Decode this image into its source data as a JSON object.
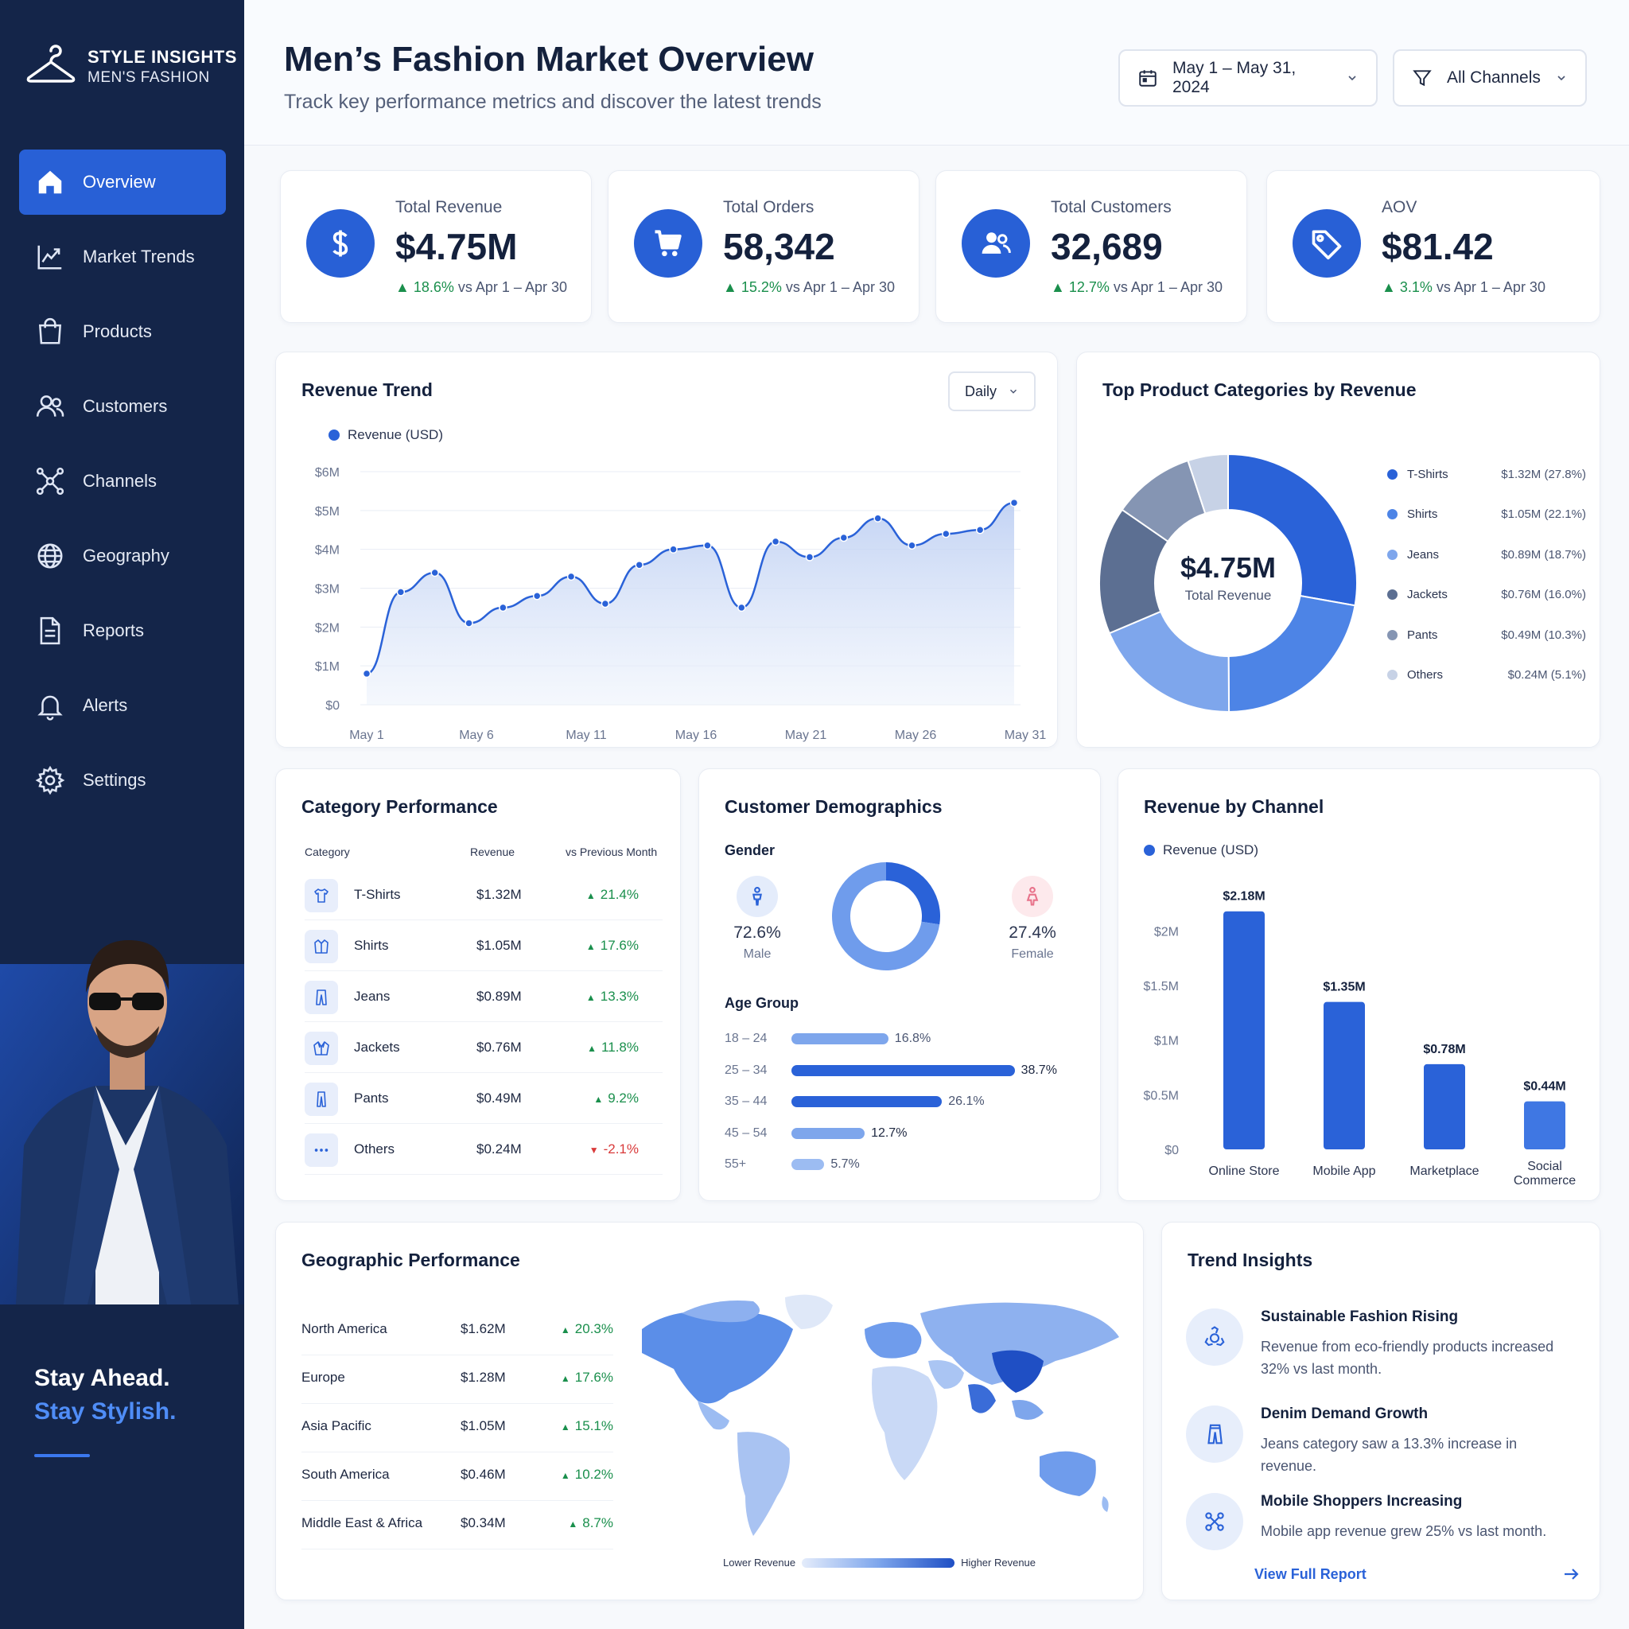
{
  "sidebar": {
    "brand_title": "STYLE INSIGHTS",
    "brand_sub": "MEN'S FASHION",
    "nav": [
      {
        "label": "Overview",
        "icon": "home-icon"
      },
      {
        "label": "Market Trends",
        "icon": "trend-icon"
      },
      {
        "label": "Products",
        "icon": "bag-icon"
      },
      {
        "label": "Customers",
        "icon": "users-icon"
      },
      {
        "label": "Channels",
        "icon": "network-icon"
      },
      {
        "label": "Geography",
        "icon": "globe-icon"
      },
      {
        "label": "Reports",
        "icon": "document-icon"
      },
      {
        "label": "Alerts",
        "icon": "bell-icon"
      },
      {
        "label": "Settings",
        "icon": "gear-icon"
      }
    ],
    "promo_line1": "Stay Ahead.",
    "promo_line2": "Stay Stylish."
  },
  "header": {
    "title": "Men’s Fashion Market Overview",
    "subtitle": "Track key performance metrics and discover the latest trends",
    "date_range": "May 1 – May 31, 2024",
    "channel_filter": "All Channels"
  },
  "kpis": [
    {
      "label": "Total Revenue",
      "value": "$4.75M",
      "delta": "18.6%",
      "compare": "vs Apr 1 – Apr 30",
      "icon": "dollar-icon"
    },
    {
      "label": "Total Orders",
      "value": "58,342",
      "delta": "15.2%",
      "compare": "vs Apr 1 – Apr 30",
      "icon": "cart-icon"
    },
    {
      "label": "Total Customers",
      "value": "32,689",
      "delta": "12.7%",
      "compare": "vs Apr 1 – Apr 30",
      "icon": "customers-icon"
    },
    {
      "label": "AOV",
      "value": "$81.42",
      "delta": "3.1%",
      "compare": "vs Apr 1 – Apr 30",
      "icon": "tag-icon"
    }
  ],
  "revenue_trend": {
    "title": "Revenue Trend",
    "granularity": "Daily",
    "legend": "Revenue (USD)"
  },
  "top_categories": {
    "title": "Top Product Categories by Revenue",
    "center_value": "$4.75M",
    "center_label": "Total Revenue",
    "items": [
      {
        "name": "T-Shirts",
        "value": "$1.32M (27.8%)",
        "color": "#2a62d8"
      },
      {
        "name": "Shirts",
        "value": "$1.05M (22.1%)",
        "color": "#4d84e6"
      },
      {
        "name": "Jeans",
        "value": "$0.89M (18.7%)",
        "color": "#7ea6ec"
      },
      {
        "name": "Jackets",
        "value": "$0.76M (16.0%)",
        "color": "#5c6f92"
      },
      {
        "name": "Pants",
        "value": "$0.49M (10.3%)",
        "color": "#8595b3"
      },
      {
        "name": "Others",
        "value": "$0.24M (5.1%)",
        "color": "#c7d2e6"
      }
    ]
  },
  "category_performance": {
    "title": "Category Performance",
    "headers": [
      "Category",
      "Revenue",
      "vs Previous Month"
    ],
    "rows": [
      {
        "name": "T-Shirts",
        "revenue": "$1.32M",
        "change": "21.4%",
        "dir": "up",
        "icon": "tshirt-icon"
      },
      {
        "name": "Shirts",
        "revenue": "$1.05M",
        "change": "17.6%",
        "dir": "up",
        "icon": "shirt-icon"
      },
      {
        "name": "Jeans",
        "revenue": "$0.89M",
        "change": "13.3%",
        "dir": "up",
        "icon": "jeans-icon"
      },
      {
        "name": "Jackets",
        "revenue": "$0.76M",
        "change": "11.8%",
        "dir": "up",
        "icon": "jacket-icon"
      },
      {
        "name": "Pants",
        "revenue": "$0.49M",
        "change": "9.2%",
        "dir": "up",
        "icon": "pants-icon"
      },
      {
        "name": "Others",
        "revenue": "$0.24M",
        "change": "-2.1%",
        "dir": "down",
        "icon": "more-icon"
      }
    ]
  },
  "demographics": {
    "title": "Customer Demographics",
    "gender_label": "Gender",
    "male_pct": "72.6%",
    "male_label": "Male",
    "female_pct": "27.4%",
    "female_label": "Female",
    "age_label": "Age Group",
    "ages": [
      {
        "range": "18 – 24",
        "pct": "16.8%",
        "value": 16.8
      },
      {
        "range": "25 – 34",
        "pct": "38.7%",
        "value": 38.7
      },
      {
        "range": "35 – 44",
        "pct": "26.1%",
        "value": 26.1
      },
      {
        "range": "45 – 54",
        "pct": "12.7%",
        "value": 12.7
      },
      {
        "range": "55+",
        "pct": "5.7%",
        "value": 5.7
      }
    ]
  },
  "channel": {
    "title": "Revenue by Channel",
    "legend": "Revenue (USD)"
  },
  "geography": {
    "title": "Geographic Performance",
    "rows": [
      {
        "region": "North America",
        "revenue": "$1.62M",
        "change": "20.3%"
      },
      {
        "region": "Europe",
        "revenue": "$1.28M",
        "change": "17.6%"
      },
      {
        "region": "Asia Pacific",
        "revenue": "$1.05M",
        "change": "15.1%"
      },
      {
        "region": "South America",
        "revenue": "$0.46M",
        "change": "10.2%"
      },
      {
        "region": "Middle East & Africa",
        "revenue": "$0.34M",
        "change": "8.7%"
      }
    ],
    "scale_low": "Lower Revenue",
    "scale_high": "Higher Revenue"
  },
  "insights": {
    "title": "Trend Insights",
    "items": [
      {
        "title": "Sustainable Fashion Rising",
        "text": "Revenue from eco-friendly products increased 32% vs last month.",
        "icon": "recycle-icon"
      },
      {
        "title": "Denim Demand Growth",
        "text": "Jeans category saw a 13.3% increase in revenue.",
        "icon": "denim-icon"
      },
      {
        "title": "Mobile Shoppers Increasing",
        "text": "Mobile app revenue grew 25% vs last month.",
        "icon": "mobile-icon"
      }
    ],
    "link": "View Full Report"
  },
  "chart_data": [
    {
      "type": "area",
      "title": "Revenue Trend",
      "series": [
        {
          "name": "Revenue (USD)",
          "values": [
            0.8,
            2.9,
            3.4,
            2.1,
            2.5,
            2.8,
            3.3,
            2.6,
            3.6,
            4.0,
            4.1,
            2.5,
            4.2,
            3.8,
            4.3,
            4.8,
            4.1,
            4.4,
            4.5,
            5.2
          ]
        }
      ],
      "x_ticks": [
        "May 1",
        "May 6",
        "May 11",
        "May 16",
        "May 21",
        "May 26",
        "May 31"
      ],
      "y_ticks": [
        "$0",
        "$1M",
        "$2M",
        "$3M",
        "$4M",
        "$5M",
        "$6M"
      ],
      "ylim": [
        0,
        6
      ],
      "grid": true
    },
    {
      "type": "pie",
      "title": "Top Product Categories by Revenue",
      "categories": [
        "T-Shirts",
        "Shirts",
        "Jeans",
        "Jackets",
        "Pants",
        "Others"
      ],
      "values": [
        1.32,
        1.05,
        0.89,
        0.76,
        0.49,
        0.24
      ]
    },
    {
      "type": "pie",
      "title": "Gender",
      "categories": [
        "Male",
        "Female"
      ],
      "values": [
        72.6,
        27.4
      ]
    },
    {
      "type": "bar",
      "title": "Age Group",
      "categories": [
        "18 – 24",
        "25 – 34",
        "35 – 44",
        "45 – 54",
        "55+"
      ],
      "values": [
        16.8,
        38.7,
        26.1,
        12.7,
        5.7
      ]
    },
    {
      "type": "bar",
      "title": "Revenue by Channel",
      "categories": [
        "Online Store",
        "Mobile App",
        "Marketplace",
        "Social Commerce"
      ],
      "values": [
        2.18,
        1.35,
        0.78,
        0.44
      ],
      "value_labels": [
        "$2.18M",
        "$1.35M",
        "$0.78M",
        "$0.44M"
      ],
      "y_ticks": [
        "$0",
        "$0.5M",
        "$1M",
        "$1.5M",
        "$2M"
      ],
      "ylim": [
        0,
        2.2
      ],
      "legend": "Revenue (USD)"
    }
  ]
}
